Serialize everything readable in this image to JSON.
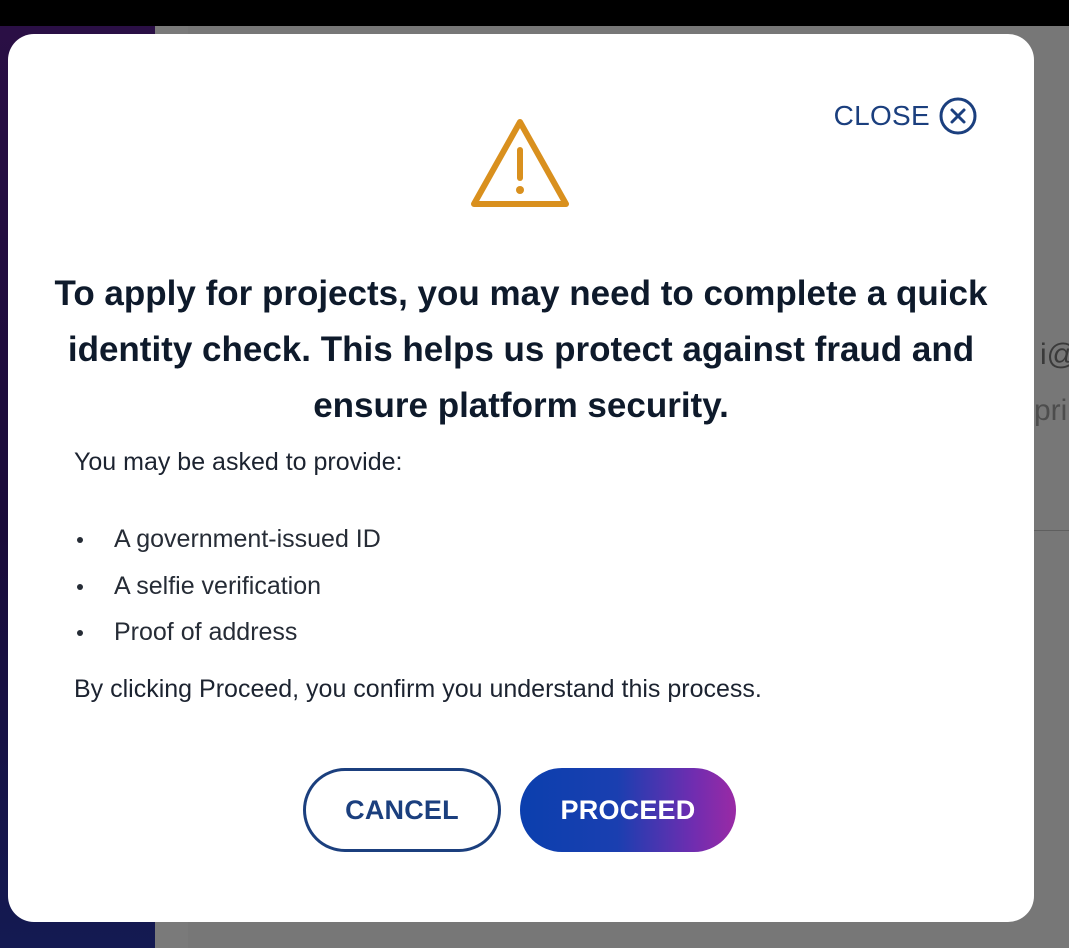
{
  "background": {
    "partial_text_1": "i@",
    "partial_text_2": "pri"
  },
  "modal": {
    "close_label": "CLOSE",
    "close_icon": "close-circle-icon",
    "warning_icon": "warning-triangle-icon",
    "headline": "To apply for projects, you may need to complete a quick identity check. This helps us protect against fraud and ensure platform security.",
    "intro": "You may be asked to provide:",
    "requirements": [
      "A government-issued ID",
      "A selfie verification",
      "Proof of address"
    ],
    "confirmation": "By clicking Proceed, you confirm you understand this process.",
    "cancel_label": "CANCEL",
    "proceed_label": "PROCEED"
  },
  "colors": {
    "accent_navy": "#1b3f7e",
    "warning_orange": "#d9901e",
    "proceed_gradient_start": "#0b3fae",
    "proceed_gradient_end": "#9a2aa5"
  }
}
